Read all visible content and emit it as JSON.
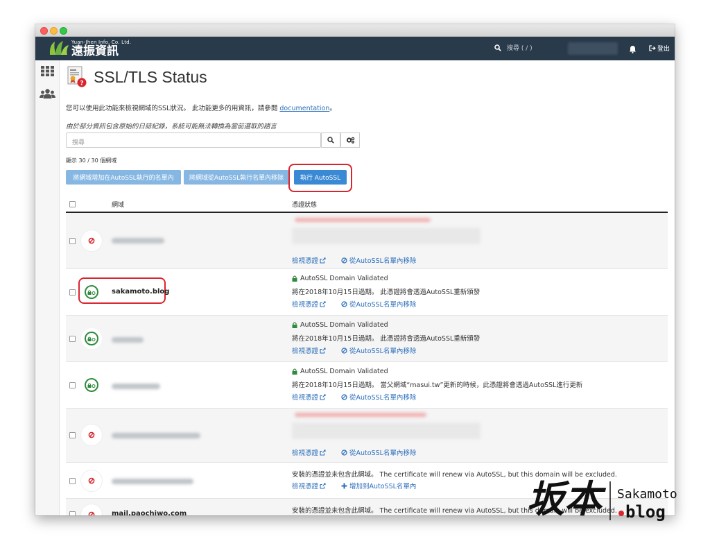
{
  "brand": {
    "en": "Yuan-Jhen Info. Co. Ltd.",
    "zh": "遠振資訊"
  },
  "topnav": {
    "search_placeholder": "搜尋 ( / )",
    "logout": "登出"
  },
  "page": {
    "title": "SSL/TLS Status"
  },
  "description": {
    "text": "您可以使用此功能來檢視網域的SSL狀況。 此功能更多的用資訊，請參閱 ",
    "link": "documentation",
    "tail": "。"
  },
  "note": "由於部分資訊包含原始的日誌紀錄，系統可能無法轉換為當前選取的語言",
  "search": {
    "placeholder": "搜尋"
  },
  "count": "顯示 30 / 30 個網域",
  "buttons": {
    "add": "將網域增加在AutoSSL執行的名單內",
    "remove": "將網域從AutoSSL執行名單內移除",
    "run": "執行 AutoSSL"
  },
  "table": {
    "col_domain": "網域",
    "col_cert": "憑證狀態"
  },
  "links": {
    "view_cert": "檢視憑證",
    "remove_from_list": "從AutoSSL名單內移除",
    "add_to_list": "增加到AutoSSL名單內"
  },
  "rows": [
    {
      "domain": "sakamoto.blog",
      "status": "AutoSSL Domain Validated",
      "detail": "將在2018年10月15日過期。 此憑證將會透過AutoSSL重新頒發"
    },
    {
      "status": "AutoSSL Domain Validated",
      "detail": "將在2018年10月15日過期。 此憑證將會透過AutoSSL重新頒發"
    },
    {
      "status": "AutoSSL Domain Validated",
      "detail": "將在2018年10月15日過期。 當父網域“masui.tw”更新的時候，此憑證將會透過AutoSSL進行更新"
    },
    {
      "detail": "安裝的憑證並未包含此網域。 The certificate will renew via AutoSSL, but this domain will be excluded."
    },
    {
      "domain": "mail.paochiwo.com",
      "detail": "安裝的憑證並未包含此網域。 The certificate will renew via AutoSSL, but this domain will be excluded."
    }
  ],
  "watermark": {
    "cjk": "坂本",
    "latin": "Sakamoto",
    "sub": ".blog"
  },
  "colors": {
    "nav": "#293a4a",
    "primary": "#3a89d4",
    "primary_light": "#86b7e3",
    "highlight": "#d9262e",
    "ok": "#2e8b3e",
    "error": "#d9262e",
    "link": "#2a6ebb"
  }
}
